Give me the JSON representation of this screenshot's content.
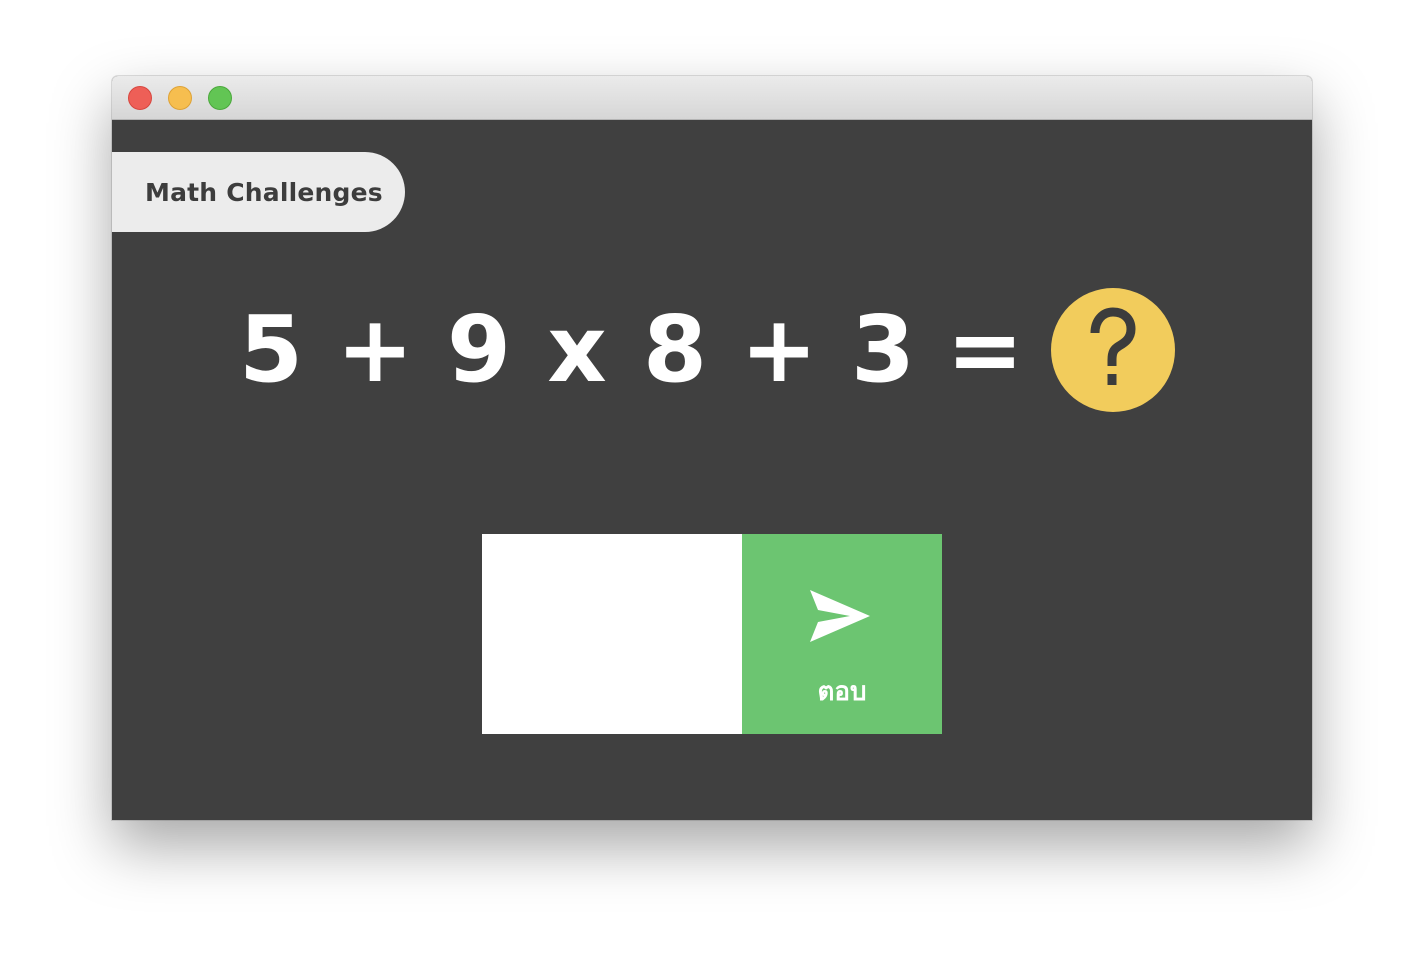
{
  "window": {
    "controls": [
      "close",
      "minimize",
      "maximize"
    ]
  },
  "app": {
    "title": "Math Challenges"
  },
  "equation": {
    "tokens": [
      "5",
      "+",
      "9",
      "x",
      "8",
      "+",
      "3",
      "="
    ],
    "unknown_icon": "question-mark-icon"
  },
  "answer": {
    "value": "",
    "placeholder": "",
    "button_label": "ตอบ",
    "button_icon": "send-icon"
  },
  "colors": {
    "background": "#404040",
    "accent_yellow": "#f2cc5c",
    "submit_green": "#6cc571",
    "tag_background": "#ececec"
  }
}
